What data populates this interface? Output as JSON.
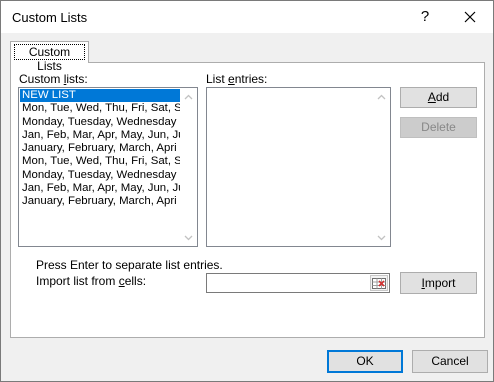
{
  "window": {
    "title": "Custom Lists",
    "help_symbol": "?"
  },
  "tab": {
    "label": "Custom Lists"
  },
  "custom_lists": {
    "label_pre": "Custom ",
    "label_key": "l",
    "label_post": "ists:",
    "selected_index": 0,
    "items": [
      "NEW LIST",
      "Mon, Tue, Wed, Thu, Fri, Sat, S",
      "Monday, Tuesday, Wednesday",
      "Jan, Feb, Mar, Apr, May, Jun, Ju",
      "January, February, March, Apri",
      "Mon, Tue, Wed, Thu, Fri, Sat, S",
      "Monday, Tuesday, Wednesday",
      "Jan, Feb, Mar, Apr, May, Jun, Ju",
      "January, February, March, Apri"
    ]
  },
  "list_entries": {
    "label_pre": "List ",
    "label_key": "e",
    "label_post": "ntries:",
    "value": ""
  },
  "buttons": {
    "add_key": "A",
    "add_rest": "dd",
    "delete_label": "Delete",
    "import_key": "I",
    "import_rest": "mport",
    "ok": "OK",
    "cancel": "Cancel"
  },
  "hint_text": "Press Enter to separate list entries.",
  "import": {
    "label_pre": "Import list from ",
    "label_key": "c",
    "label_post": "ells:",
    "value": ""
  },
  "icons": {
    "help": "help-icon",
    "close": "close-icon",
    "scroll_up": "chevron-up-icon",
    "scroll_down": "chevron-down-icon",
    "range_select": "range-select-icon"
  },
  "colors": {
    "selection": "#0078d7",
    "dialog_bg": "#f0f0f0",
    "default_button_border": "#0078d7"
  }
}
